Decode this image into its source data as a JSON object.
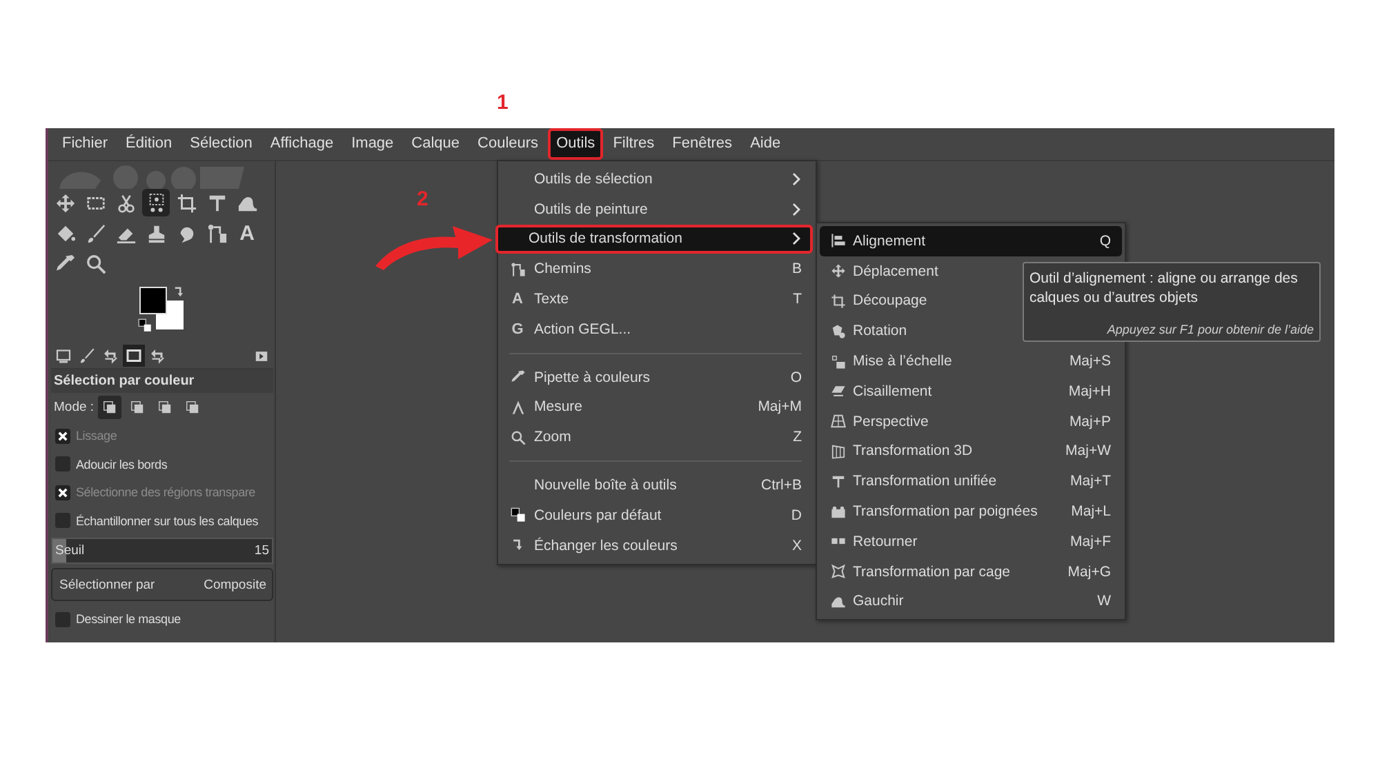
{
  "annotations": [
    {
      "label": "1"
    },
    {
      "label": "2"
    }
  ],
  "menubar": [
    {
      "label": "Fichier",
      "selected": false,
      "marked": false
    },
    {
      "label": "Édition",
      "selected": false,
      "marked": false
    },
    {
      "label": "Sélection",
      "selected": false,
      "marked": false
    },
    {
      "label": "Affichage",
      "selected": false,
      "marked": false
    },
    {
      "label": "Image",
      "selected": false,
      "marked": false
    },
    {
      "label": "Calque",
      "selected": false,
      "marked": false
    },
    {
      "label": "Couleurs",
      "selected": false,
      "marked": false
    },
    {
      "label": "Outils",
      "selected": true,
      "marked": true
    },
    {
      "label": "Filtres",
      "selected": false,
      "marked": false
    },
    {
      "label": "Fenêtres",
      "selected": false,
      "marked": false
    },
    {
      "label": "Aide",
      "selected": false,
      "marked": false
    }
  ],
  "toolbox": {
    "tools": [
      {
        "selected": false
      },
      {
        "selected": false
      },
      {
        "selected": false
      },
      {
        "selected": true
      },
      {
        "selected": false
      },
      {
        "selected": false
      },
      {
        "selected": false
      },
      {
        "selected": false
      },
      {
        "selected": false
      },
      {
        "selected": false
      },
      {
        "selected": false
      },
      {
        "selected": false
      },
      {
        "selected": false
      },
      {
        "glyph": "A",
        "selected": false
      },
      {
        "selected": false
      },
      {
        "selected": false
      }
    ],
    "dock_tabs": [
      {
        "selected": false
      },
      {
        "selected": false
      },
      {
        "selected": false
      },
      {
        "selected": true
      },
      {
        "selected": false
      }
    ]
  },
  "tool_options": {
    "title": "Sélection par couleur",
    "mode_label": "Mode :",
    "modes": [
      {
        "selected": true
      },
      {
        "selected": false
      },
      {
        "selected": false
      },
      {
        "selected": false
      }
    ],
    "options": [
      {
        "kind": "checkbox",
        "label": "Lissage",
        "checked": true,
        "disabled": true
      },
      {
        "kind": "checkbox",
        "label": "Adoucir les bords",
        "checked": false,
        "disabled": false
      },
      {
        "kind": "checkbox",
        "label": "Sélectionne des régions transpare",
        "checked": true,
        "disabled": true
      },
      {
        "kind": "checkbox",
        "label": "Échantillonner sur tous les calques",
        "checked": false,
        "disabled": false
      },
      {
        "kind": "slider",
        "label": "Seuil",
        "value": "15",
        "level": 0.06
      },
      {
        "kind": "dropdown",
        "label": "Sélectionner par",
        "value": "Composite"
      },
      {
        "kind": "checkbox",
        "label": "Dessiner le masque",
        "checked": false,
        "disabled": false
      }
    ]
  },
  "menu": [
    {
      "kind": "item",
      "label": "Outils de sélection",
      "submenu": true,
      "selected": false,
      "marked": false
    },
    {
      "kind": "item",
      "label": "Outils de peinture",
      "submenu": true,
      "selected": false,
      "marked": false
    },
    {
      "kind": "item",
      "label": "Outils de transformation",
      "submenu": true,
      "selected": true,
      "marked": true
    },
    {
      "kind": "item",
      "label": "Chemins",
      "shortcut": "B",
      "selected": false,
      "marked": false
    },
    {
      "kind": "item",
      "label": "Texte",
      "shortcut": "T",
      "glyph": "A",
      "selected": false,
      "marked": false
    },
    {
      "kind": "item",
      "label": "Action GEGL...",
      "glyph": "G",
      "selected": false,
      "marked": false
    },
    {
      "kind": "separator"
    },
    {
      "kind": "item",
      "label": "Pipette à couleurs",
      "shortcut": "O",
      "selected": false,
      "marked": false
    },
    {
      "kind": "item",
      "label": "Mesure",
      "shortcut": "Maj+M",
      "selected": false,
      "marked": false
    },
    {
      "kind": "item",
      "label": "Zoom",
      "shortcut": "Z",
      "selected": false,
      "marked": false
    },
    {
      "kind": "separator"
    },
    {
      "kind": "item",
      "label": "Nouvelle boîte à outils",
      "shortcut": "Ctrl+B",
      "selected": false,
      "marked": false
    },
    {
      "kind": "item",
      "label": "Couleurs par défaut",
      "shortcut": "D",
      "selected": false,
      "marked": false
    },
    {
      "kind": "item",
      "label": "Échanger les couleurs",
      "shortcut": "X",
      "selected": false,
      "marked": false
    }
  ],
  "submenu": [
    {
      "label": "Alignement",
      "shortcut": "Q",
      "selected": true
    },
    {
      "label": "Déplacement",
      "selected": false
    },
    {
      "label": "Découpage",
      "selected": false
    },
    {
      "label": "Rotation",
      "selected": false
    },
    {
      "label": "Mise à l’échelle",
      "shortcut": "Maj+S",
      "selected": false
    },
    {
      "label": "Cisaillement",
      "shortcut": "Maj+H",
      "selected": false
    },
    {
      "label": "Perspective",
      "shortcut": "Maj+P",
      "selected": false
    },
    {
      "label": "Transformation 3D",
      "shortcut": "Maj+W",
      "selected": false
    },
    {
      "label": "Transformation unifiée",
      "shortcut": "Maj+T",
      "selected": false
    },
    {
      "label": "Transformation par poignées",
      "shortcut": "Maj+L",
      "selected": false
    },
    {
      "label": "Retourner",
      "shortcut": "Maj+F",
      "selected": false
    },
    {
      "label": "Transformation par cage",
      "shortcut": "Maj+G",
      "selected": false
    },
    {
      "label": "Gauchir",
      "shortcut": "W",
      "selected": false
    }
  ],
  "tooltip": {
    "text": "Outil d’alignement : aligne ou arrange des calques ou d’autres objets",
    "hint": "Appuyez sur F1 pour obtenir de l’aide"
  }
}
